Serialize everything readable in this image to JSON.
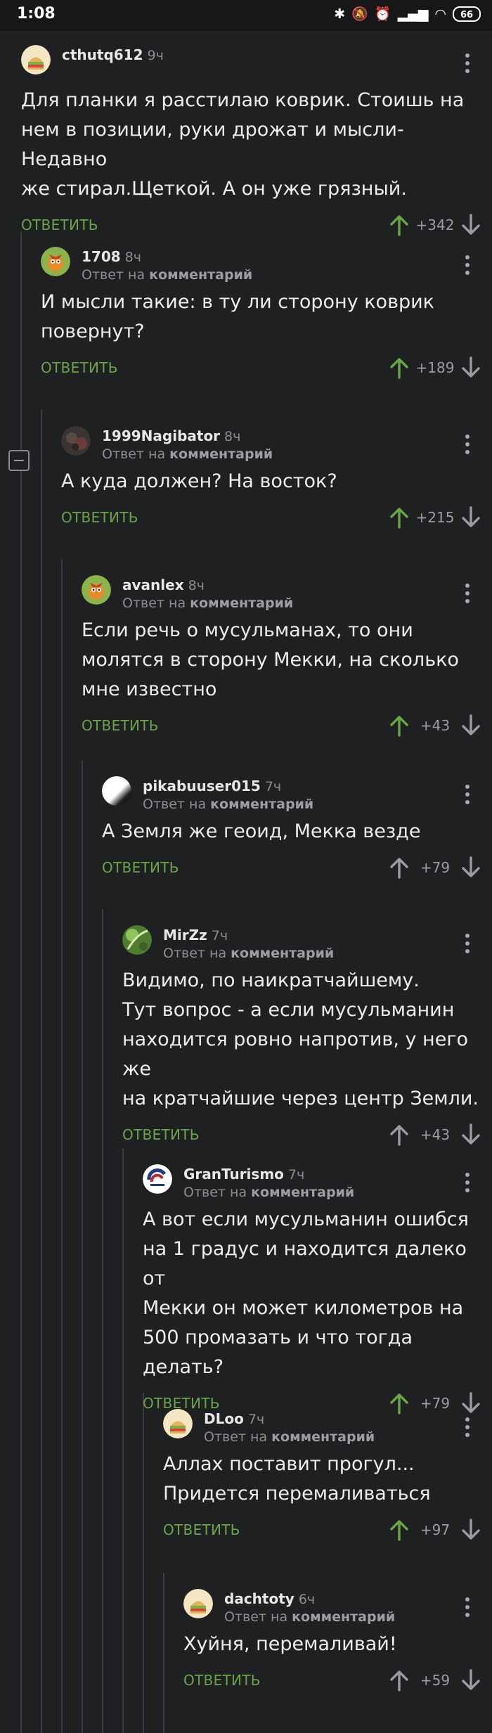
{
  "status_bar": {
    "time": "1:08",
    "battery": "66"
  },
  "labels": {
    "reply_to_prefix": "Ответ на",
    "reply_to_target": "комментарий"
  },
  "colors": {
    "background": "#1f2022",
    "reply_link": "#6aa548",
    "upvote_active": "#6aa548",
    "upvote_inactive": "#9b9ca0",
    "downvote": "#9b9ca0"
  },
  "comments": [
    {
      "author": "cthutq612",
      "time": "9ч",
      "is_reply": false,
      "text": "Для планки я расстилаю коврик. Стоишь на\nнем в позиции, руки дрожат и мысли- Недавно\nже стирал.Щеткой. А он уже грязный.",
      "reply_label": "ОТВЕТИТЬ",
      "score": "+342",
      "upvoted": true,
      "avatar_icon": "sandwich-avatar"
    },
    {
      "author": "1708",
      "time": "8ч",
      "is_reply": true,
      "text": "И мысли такие: в ту ли сторону коврик\nповернут?",
      "reply_label": "ОТВЕТИТЬ",
      "score": "+189",
      "upvoted": true,
      "avatar_icon": "bird-avatar"
    },
    {
      "author": "1999Nagibator",
      "time": "8ч",
      "is_reply": true,
      "text": "А куда должен? На восток?",
      "reply_label": "ОТВЕТИТЬ",
      "score": "+215",
      "upvoted": true,
      "avatar_icon": "photo-avatar"
    },
    {
      "author": "avanlex",
      "time": "8ч",
      "is_reply": true,
      "text": "Если речь о мусульманах, то они\nмолятся в сторону Мекки, на сколько\nмне известно",
      "reply_label": "ОТВЕТИТЬ",
      "score": "+43",
      "upvoted": true,
      "avatar_icon": "bird-avatar"
    },
    {
      "author": "pikabuuser015",
      "time": "7ч",
      "is_reply": true,
      "text": "А Земля же геоид, Мекка везде",
      "reply_label": "ОТВЕТИТЬ",
      "score": "+79",
      "upvoted": false,
      "avatar_icon": "moon-avatar"
    },
    {
      "author": "MirZz",
      "time": "7ч",
      "is_reply": true,
      "text": "Видимо, по наикратчайшему.\nТут вопрос - а если мусульманин\nнаходится ровно напротив, у него же\nна кратчайшие через центр Земли.",
      "reply_label": "ОТВЕТИТЬ",
      "score": "+43",
      "upvoted": false,
      "avatar_icon": "leaf-avatar"
    },
    {
      "author": "GranTurismo",
      "time": "7ч",
      "is_reply": true,
      "text": "А вот если мусульманин ошибся\nна 1 градус и находится далеко от\nМекки он может километров на\n500 промазать и что тогда делать?",
      "reply_label": "ОТВЕТИТЬ",
      "score": "+79",
      "upvoted": true,
      "avatar_icon": "gt-logo-avatar"
    },
    {
      "author": "DLoo",
      "time": "7ч",
      "is_reply": true,
      "text": "Аллах поставит прогул...\nПридется перемаливаться",
      "reply_label": "ОТВЕТИТЬ",
      "score": "+97",
      "upvoted": true,
      "avatar_icon": "sandwich-avatar"
    },
    {
      "author": "dachtoty",
      "time": "6ч",
      "is_reply": true,
      "text": "Хуйня, перемаливай!",
      "reply_label": "ОТВЕТИТЬ",
      "score": "+59",
      "upvoted": false,
      "avatar_icon": "sandwich-avatar"
    }
  ]
}
